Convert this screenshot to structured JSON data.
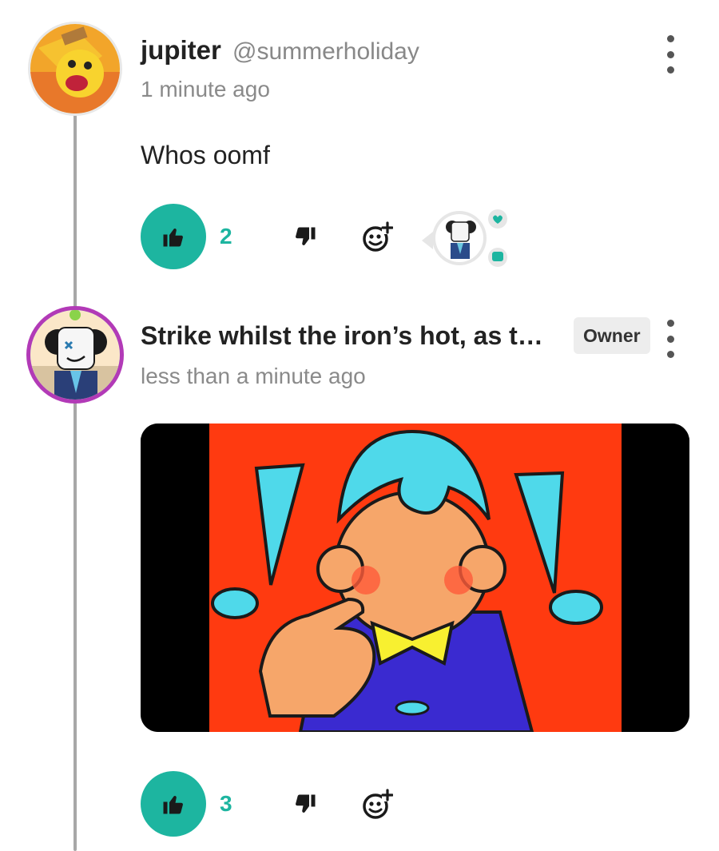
{
  "comments": [
    {
      "username": "jupiter",
      "handle": "@summerholiday",
      "timestamp": "1 minute ago",
      "body": "Whos oomf",
      "likes": "2"
    },
    {
      "username": "Strike whilst the iron’s hot, as they say",
      "badge": "Owner",
      "timestamp": "less than a minute ago",
      "likes": "3"
    }
  ],
  "colors": {
    "accent": "#1db5a0",
    "text": "#222222",
    "muted": "#8a8a8a",
    "thread": "#a7a7a7"
  },
  "icons": {
    "like": "thumbs-up-icon",
    "dislike": "thumbs-down-icon",
    "react": "add-reaction-icon",
    "more": "more-vertical-icon"
  }
}
